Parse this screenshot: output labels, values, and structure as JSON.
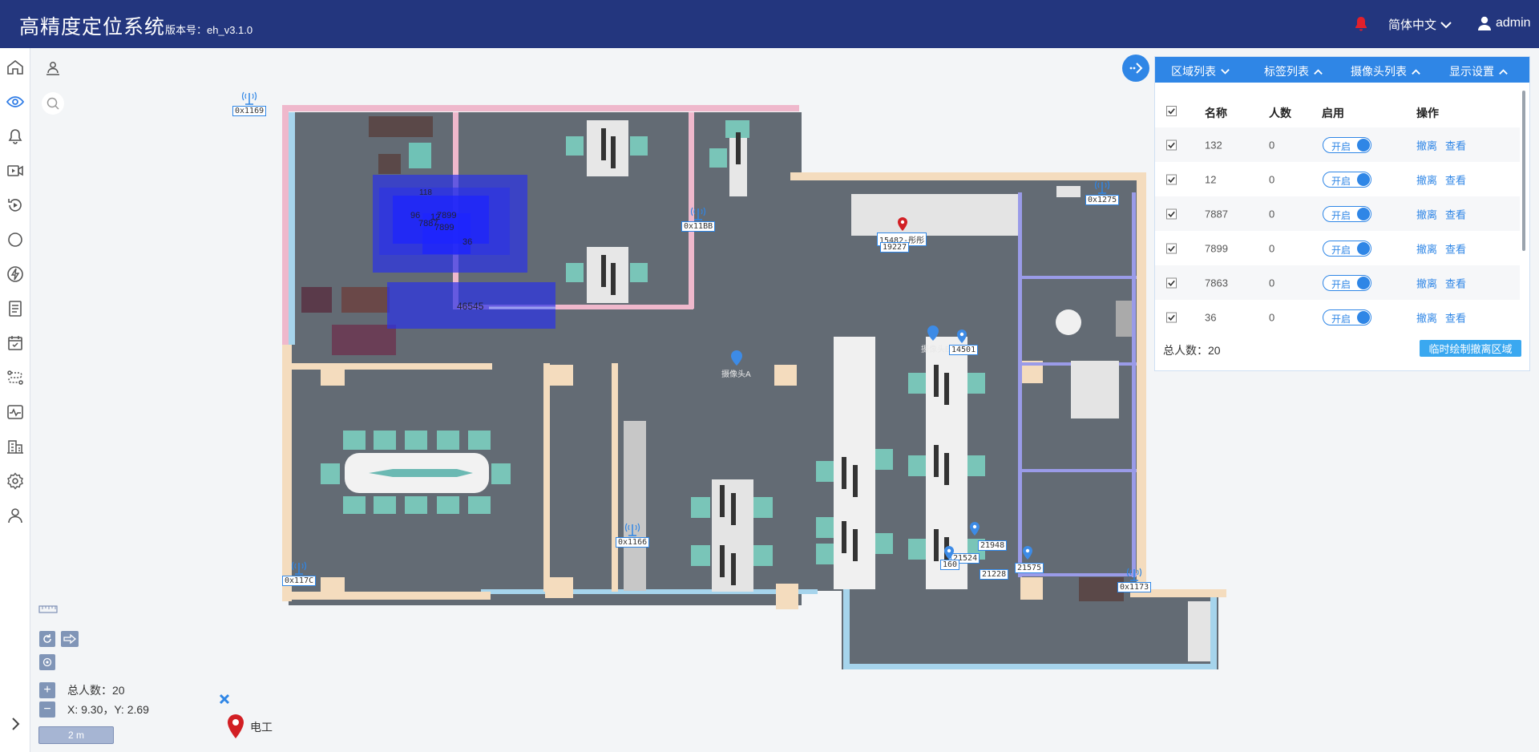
{
  "header": {
    "title": "高精度定位系统",
    "version": "版本号：eh_v3.1.0",
    "language": "简体中文",
    "user": "admin"
  },
  "sidebar": {
    "items": [
      "home-icon",
      "eye-icon",
      "bell-icon",
      "video-icon",
      "replay-icon",
      "circle-icon",
      "power-icon",
      "document-icon",
      "calendar-icon",
      "route-icon",
      "chart-icon",
      "building-icon",
      "gear-icon",
      "user-icon"
    ]
  },
  "panel": {
    "tabs": [
      {
        "label": "区域列表",
        "chevron": "down"
      },
      {
        "label": "标签列表",
        "chevron": "up"
      },
      {
        "label": "摄像头列表",
        "chevron": "up"
      },
      {
        "label": "显示设置",
        "chevron": "up"
      }
    ],
    "columns": [
      "名称",
      "人数",
      "启用",
      "操作"
    ],
    "rows": [
      {
        "name": "132",
        "count": "0",
        "toggle": "开启",
        "op1": "撤离",
        "op2": "查看"
      },
      {
        "name": "12",
        "count": "0",
        "toggle": "开启",
        "op1": "撤离",
        "op2": "查看"
      },
      {
        "name": "7887",
        "count": "0",
        "toggle": "开启",
        "op1": "撤离",
        "op2": "查看"
      },
      {
        "name": "7899",
        "count": "0",
        "toggle": "开启",
        "op1": "撤离",
        "op2": "查看"
      },
      {
        "name": "7863",
        "count": "0",
        "toggle": "开启",
        "op1": "撤离",
        "op2": "查看"
      },
      {
        "name": "36",
        "count": "0",
        "toggle": "开启",
        "op1": "撤离",
        "op2": "查看"
      }
    ],
    "total_label": "总人数：",
    "total_value": "20",
    "draw_button": "临时绘制撤离区域"
  },
  "map": {
    "anchors": [
      "0x1169",
      "0x11BB",
      "0x1275",
      "0x1166",
      "0x117C",
      "0x1173"
    ],
    "tags": [
      "15482-彤彤",
      "19227",
      "14501",
      "21948",
      "21524",
      "21575",
      "21228",
      "160"
    ],
    "cameras": [
      "摄像头A",
      "摄像头B"
    ],
    "zones": [
      "118",
      "96",
      "12",
      "7899",
      "7887",
      "36",
      "46545"
    ],
    "total_label": "总人数：",
    "total_value": "20",
    "coords": "X: 9.30，Y: 2.69",
    "scale": "2 m",
    "legend_label": "电工"
  }
}
